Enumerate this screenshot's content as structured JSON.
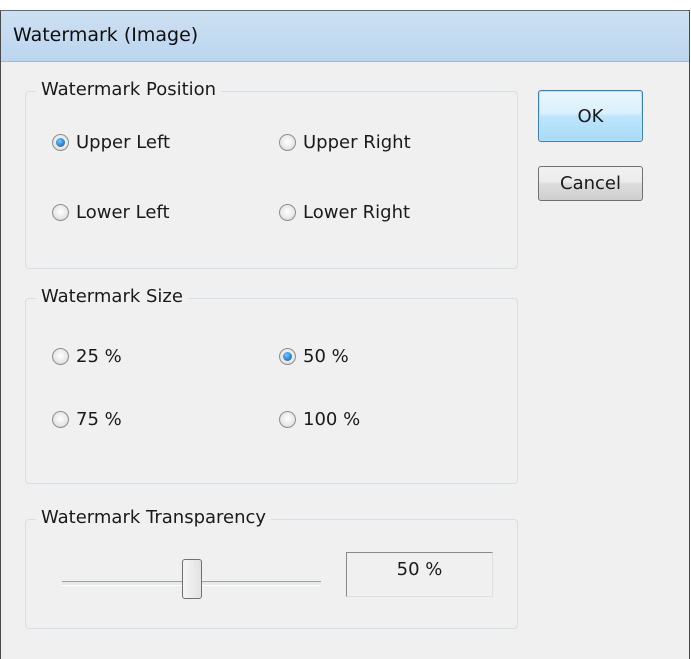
{
  "window": {
    "title": "Watermark (Image)"
  },
  "position": {
    "legend": "Watermark Position",
    "options": [
      "Upper Left",
      "Upper Right",
      "Lower Left",
      "Lower Right"
    ],
    "selected": "Upper Left"
  },
  "size": {
    "legend": "Watermark Size",
    "options": [
      "25 %",
      "50 %",
      "75 %",
      "100 %"
    ],
    "selected": "50 %"
  },
  "transparency": {
    "legend": "Watermark Transparency",
    "value": 0.5,
    "value_label": "50 %"
  },
  "buttons": {
    "ok": "OK",
    "cancel": "Cancel"
  },
  "colors": {
    "titlebar": "#c4dbf0",
    "dialog_bg": "#f0f0f0",
    "accent": "#2a86d6"
  }
}
